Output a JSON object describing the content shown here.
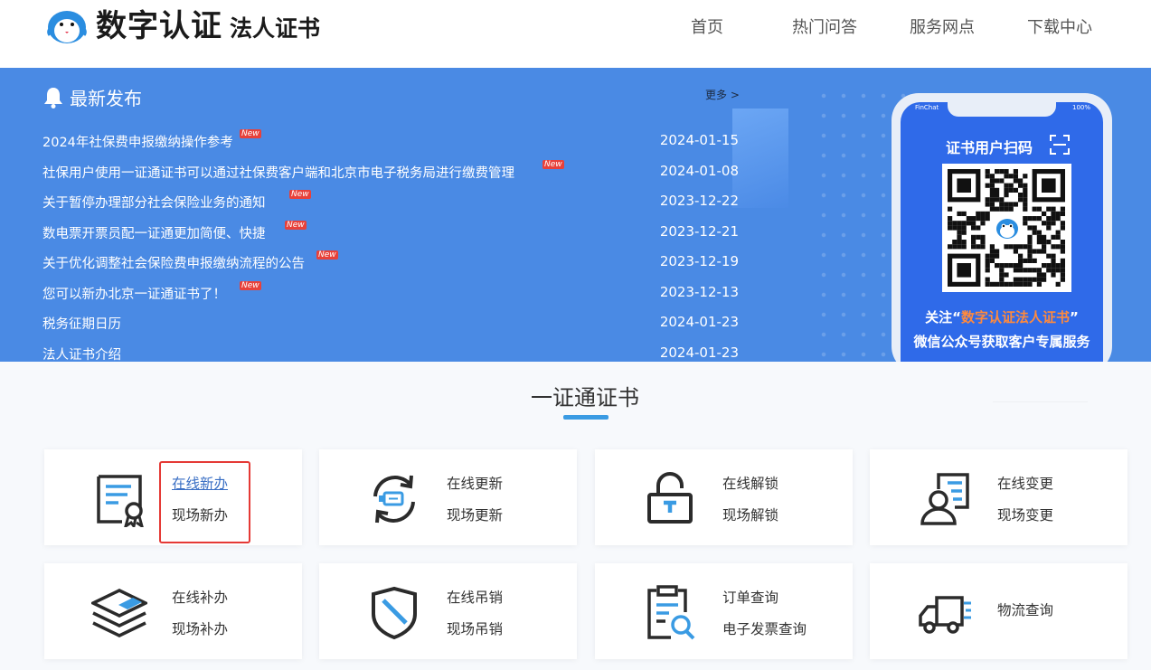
{
  "header": {
    "logo_main": "数字认证",
    "logo_sub": "法人证书",
    "nav": [
      "首页",
      "热门问答",
      "服务网点",
      "下载中心"
    ]
  },
  "news": {
    "title": "最新发布",
    "more": "更多 >",
    "new_label": "New",
    "items": [
      {
        "text": "2024年社保费申报缴纳操作参考",
        "date": "2024-01-15",
        "is_new": true
      },
      {
        "text": "社保用户使用一证通证书可以通过社保费客户端和北京市电子税务局进行缴费管理",
        "date": "2024-01-08",
        "is_new": true
      },
      {
        "text": "关于暂停办理部分社会保险业务的通知",
        "date": "2023-12-22",
        "is_new": true
      },
      {
        "text": "数电票开票员配一证通更加简便、快捷",
        "date": "2023-12-21",
        "is_new": true
      },
      {
        "text": "关于优化调整社会保险费申报缴纳流程的公告",
        "date": "2023-12-19",
        "is_new": true
      },
      {
        "text": "您可以新办北京一证通证书了！",
        "date": "2023-12-13",
        "is_new": true
      },
      {
        "text": "税务征期日历",
        "date": "2024-01-23",
        "is_new": false
      },
      {
        "text": "法人证书介绍",
        "date": "2024-01-23",
        "is_new": false
      }
    ]
  },
  "phone": {
    "status_left": "FinChat",
    "status_right": "100%",
    "scan_title": "证书用户扫码",
    "follow_prefix": "关注“",
    "follow_name": "数字认证法人证书",
    "follow_suffix": "”",
    "follow_line2": "微信公众号获取客户专属服务"
  },
  "section": {
    "title": "一证通证书"
  },
  "services": [
    {
      "icon": "certificate-icon",
      "a": "在线新办",
      "b": "现场新办"
    },
    {
      "icon": "refresh-usb-icon",
      "a": "在线更新",
      "b": "现场更新"
    },
    {
      "icon": "unlock-icon",
      "a": "在线解锁",
      "b": "现场解锁"
    },
    {
      "icon": "user-change-icon",
      "a": "在线变更",
      "b": "现场变更"
    },
    {
      "icon": "layers-icon",
      "a": "在线补办",
      "b": "现场补办"
    },
    {
      "icon": "shield-revoke-icon",
      "a": "在线吊销",
      "b": "现场吊销"
    },
    {
      "icon": "clipboard-search-icon",
      "a": "订单查询",
      "b": "电子发票查询"
    },
    {
      "icon": "truck-icon",
      "a": "物流查询",
      "b": ""
    }
  ],
  "colors": {
    "banner": "#4a8ae4",
    "accent": "#3a9be3",
    "new_badge": "#e8413a",
    "highlight": "#e53935",
    "follow_name": "#ff8a3d"
  }
}
